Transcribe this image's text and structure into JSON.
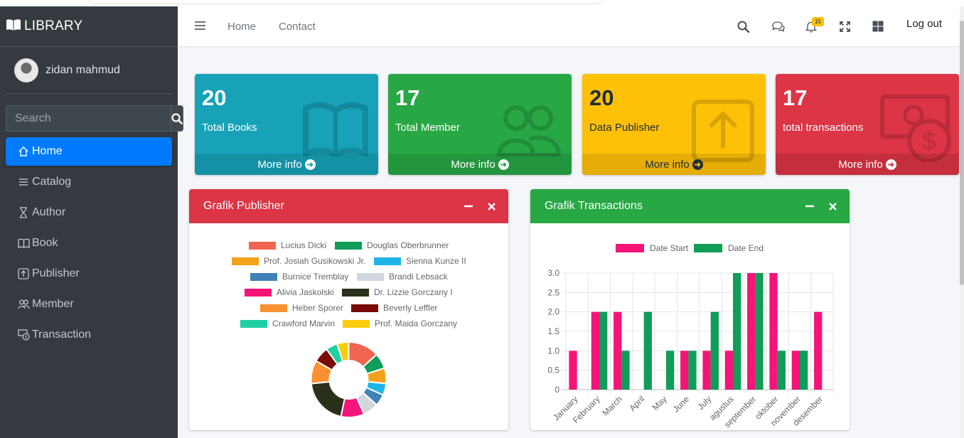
{
  "brand": {
    "title": "LIBRARY",
    "icon": "book-open-icon"
  },
  "user": {
    "name": "zidan mahmud"
  },
  "search": {
    "placeholder": "Search"
  },
  "sidebar": {
    "items": [
      {
        "label": "Home",
        "icon": "home-icon",
        "active": true
      },
      {
        "label": "Catalog",
        "icon": "list-icon"
      },
      {
        "label": "Author",
        "icon": "hourglass-icon"
      },
      {
        "label": "Book",
        "icon": "book-icon"
      },
      {
        "label": "Publisher",
        "icon": "upload-square-icon"
      },
      {
        "label": "Member",
        "icon": "people-icon"
      },
      {
        "label": "Transaction",
        "icon": "cash-coin-icon"
      }
    ]
  },
  "topbar": {
    "links": [
      "Home",
      "Contact"
    ],
    "notification_count": "15",
    "logout_label": "Log out"
  },
  "stats": [
    {
      "value": "20",
      "label": "Total Books",
      "more": "More info",
      "color": "#17a2b8",
      "text_color": "#ffffff",
      "icon": "book-icon"
    },
    {
      "value": "17",
      "label": "Total Member",
      "more": "More info",
      "color": "#28a745",
      "text_color": "#ffffff",
      "icon": "people-icon"
    },
    {
      "value": "20",
      "label": "Data Publisher",
      "more": "More info",
      "color": "#ffc107",
      "text_color": "#1f2d3d",
      "icon": "upload-square-icon"
    },
    {
      "value": "17",
      "label": "total transactions",
      "more": "More info",
      "color": "#dc3545",
      "text_color": "#ffffff",
      "icon": "cash-coin-icon"
    }
  ],
  "cards": {
    "publisher": {
      "title": "Grafik Publisher",
      "color": "#dc3545"
    },
    "transactions": {
      "title": "Grafik Transactions",
      "color": "#28a745"
    }
  },
  "chart_data": [
    {
      "type": "pie",
      "variant": "doughnut",
      "title": "",
      "legend_position": "top",
      "labels": [
        "Lucius Dicki",
        "Douglas Oberbrunner",
        "Prof. Josiah Gusikowski Jr.",
        "Sienna Kunze II",
        "Burnice Tremblay",
        "Brandi Lebsack",
        "Alivia Jaskolski",
        "Dr. Lizzie Gorczany I",
        "Heber Sporer",
        "Beverly Leffler",
        "Crawford Marvin",
        "Prof. Maida Gorczany"
      ],
      "values": [
        4,
        2,
        2,
        1.5,
        1.5,
        2,
        3,
        6,
        3,
        2,
        1.5,
        1.5
      ],
      "colors": [
        "#f0654f",
        "#0f9d58",
        "#f4a11c",
        "#1fb5e8",
        "#4081b6",
        "#d2d6de",
        "#f4147a",
        "#29311a",
        "#f89131",
        "#7a0a0a",
        "#1ed0a3",
        "#fbcc0d"
      ]
    },
    {
      "type": "bar",
      "title": "",
      "legend_position": "top",
      "categories": [
        "January",
        "February",
        "March",
        "April",
        "May",
        "June",
        "July",
        "agustus",
        "september",
        "oktober",
        "november",
        "desember"
      ],
      "series": [
        {
          "name": "Date Start",
          "color": "#f4147a",
          "values": [
            1,
            2,
            2,
            0,
            0,
            1,
            1,
            1,
            3,
            3,
            1,
            2
          ]
        },
        {
          "name": "Date End",
          "color": "#0f9d58",
          "values": [
            0,
            2,
            1,
            2,
            1,
            1,
            2,
            3,
            3,
            1,
            1,
            0
          ]
        }
      ],
      "ylim": [
        0,
        3
      ],
      "yticks": [
        "0",
        "0.5",
        "1.0",
        "1.5",
        "2.0",
        "2.5",
        "3.0"
      ],
      "grid": true
    }
  ]
}
